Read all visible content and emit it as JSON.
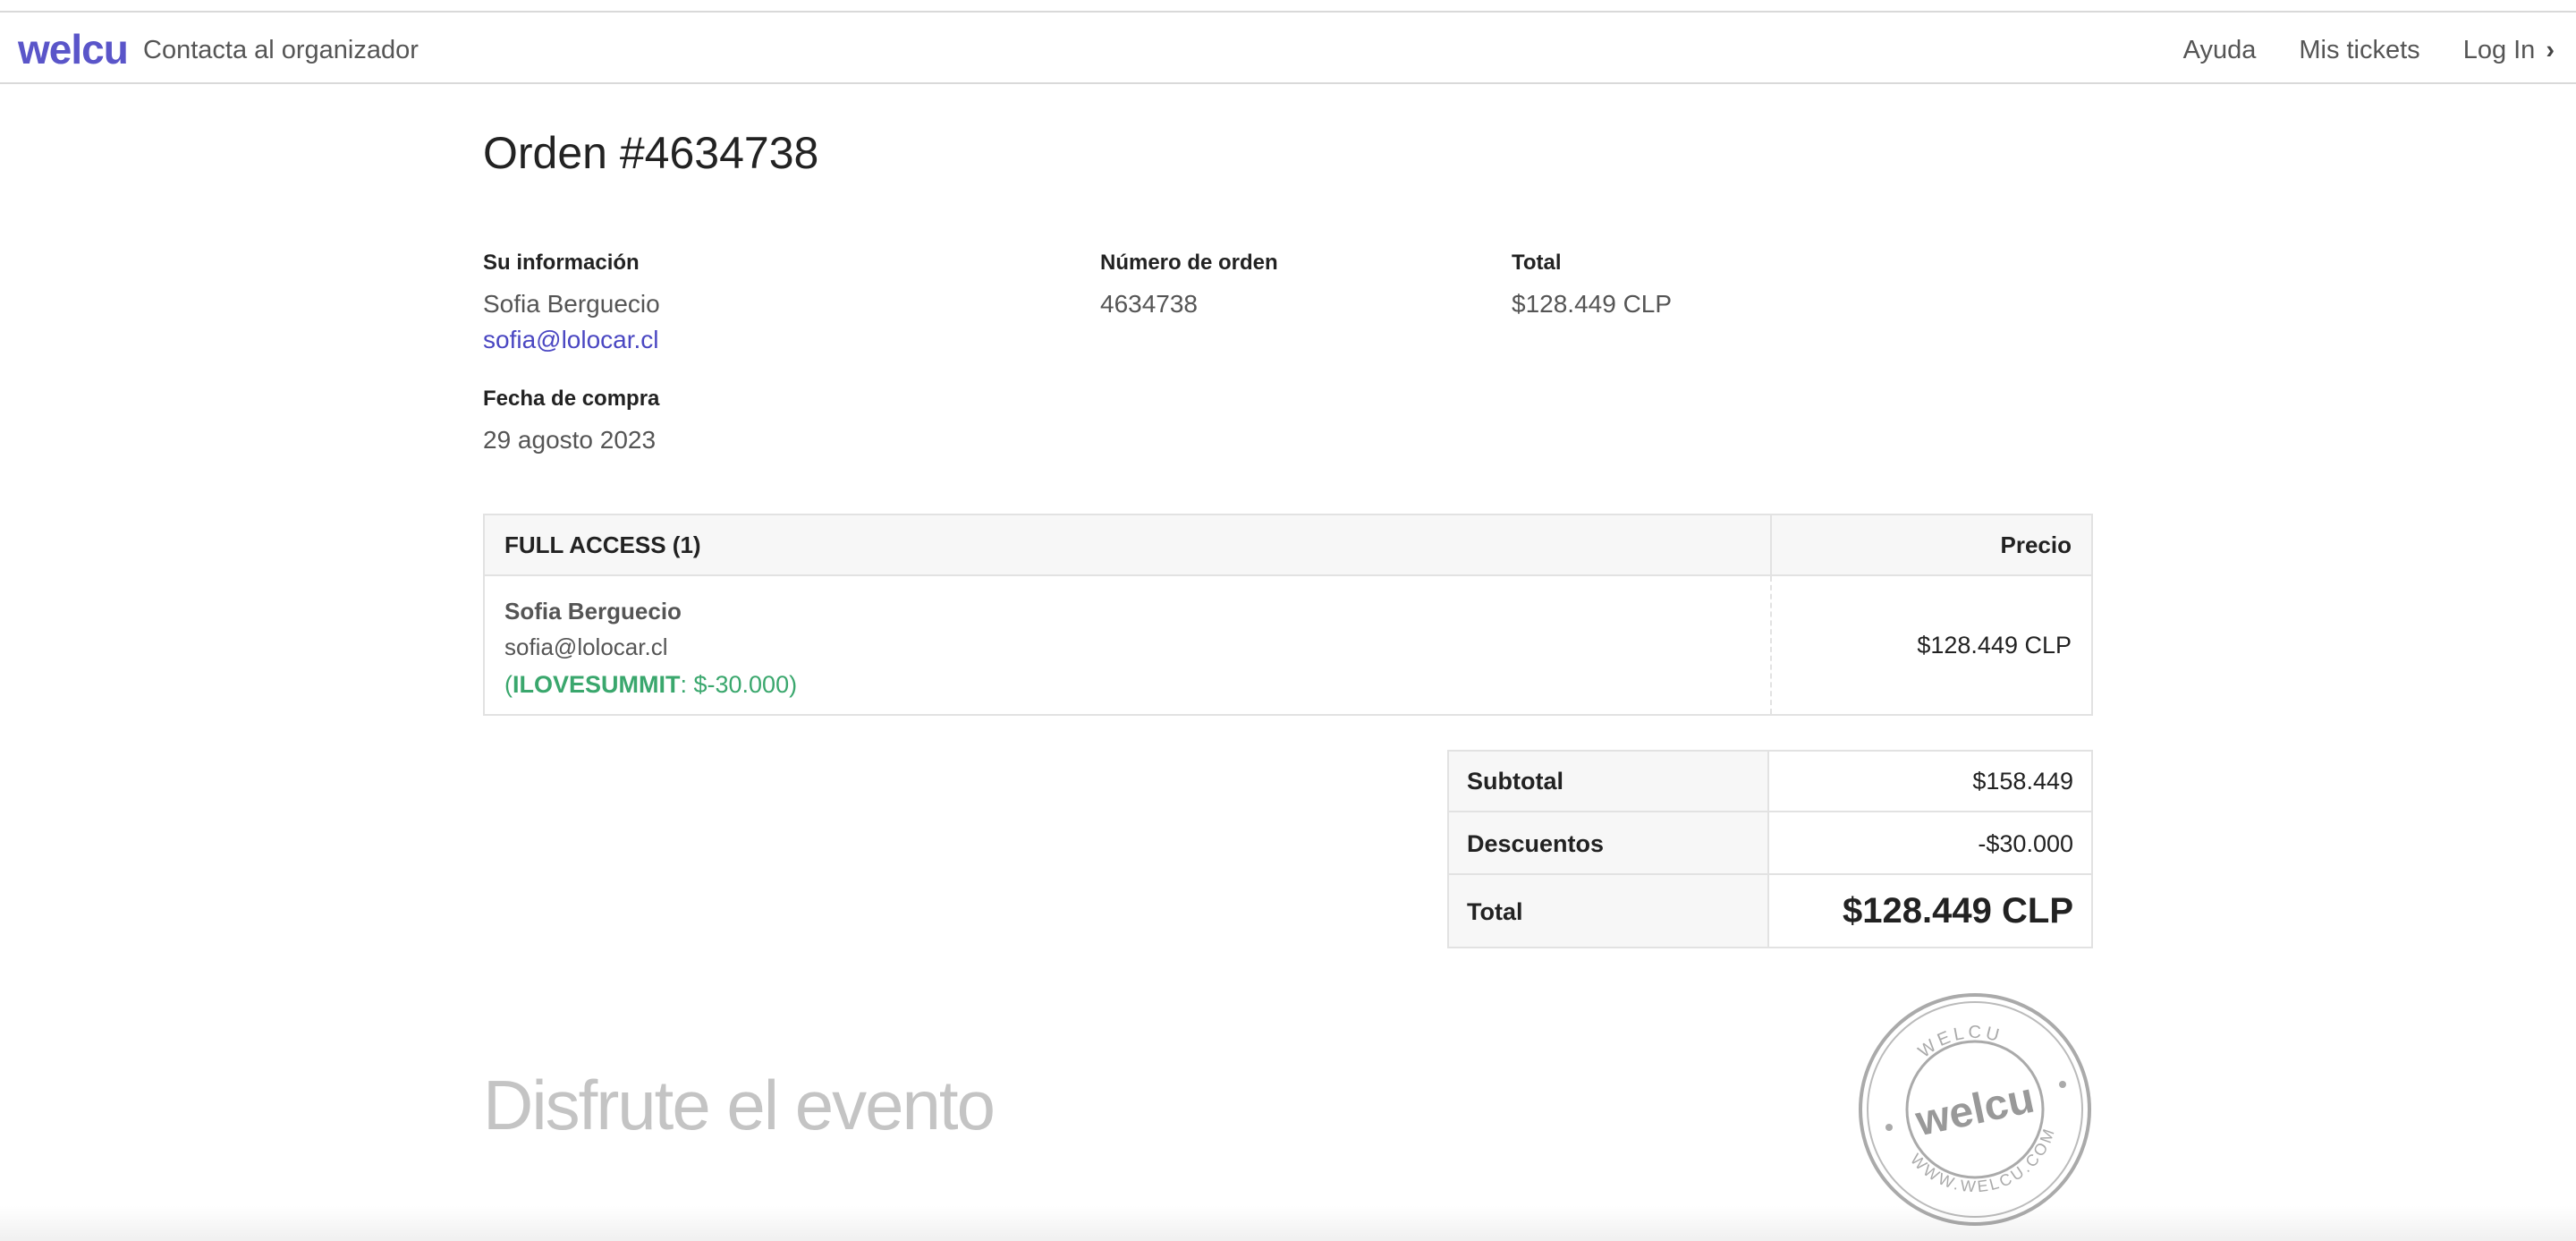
{
  "navbar": {
    "logo": "welcu",
    "organizer_link": "Contacta al organizador",
    "help": "Ayuda",
    "my_tickets": "Mis tickets",
    "login": "Log In",
    "chevron": "›"
  },
  "order": {
    "title": "Orden #4634738",
    "your_info_label": "Su información",
    "customer_name": "Sofia Berguecio",
    "customer_email": "sofia@lolocar.cl",
    "order_number_label": "Número de orden",
    "order_number": "4634738",
    "total_label": "Total",
    "total": "$128.449 CLP",
    "purchase_date_label": "Fecha de compra",
    "purchase_date": "29 agosto 2023"
  },
  "items_table": {
    "ticket_header": "FULL ACCESS (1)",
    "price_header": "Precio",
    "rows": [
      {
        "name": "Sofia Berguecio",
        "email": "sofia@lolocar.cl",
        "discount_open": "(",
        "discount_code": "ILOVESUMMIT",
        "discount_amount": ": $-30.000)",
        "price": "$128.449 CLP"
      }
    ]
  },
  "totals": {
    "subtotal_label": "Subtotal",
    "subtotal": "$158.449",
    "discounts_label": "Descuentos",
    "discounts": "-$30.000",
    "total_label": "Total",
    "total": "$128.449 CLP"
  },
  "footer": {
    "enjoy_text": "Disfrute el evento",
    "stamp_icon": "welcu-stamp-icon",
    "stamp_top": "WELCU",
    "stamp_center": "welcu",
    "stamp_bottom": "WWW.WELCU.COM"
  },
  "colors": {
    "brand": "#5a55c9",
    "link": "#4a47c2",
    "discount": "#3aa76d"
  }
}
